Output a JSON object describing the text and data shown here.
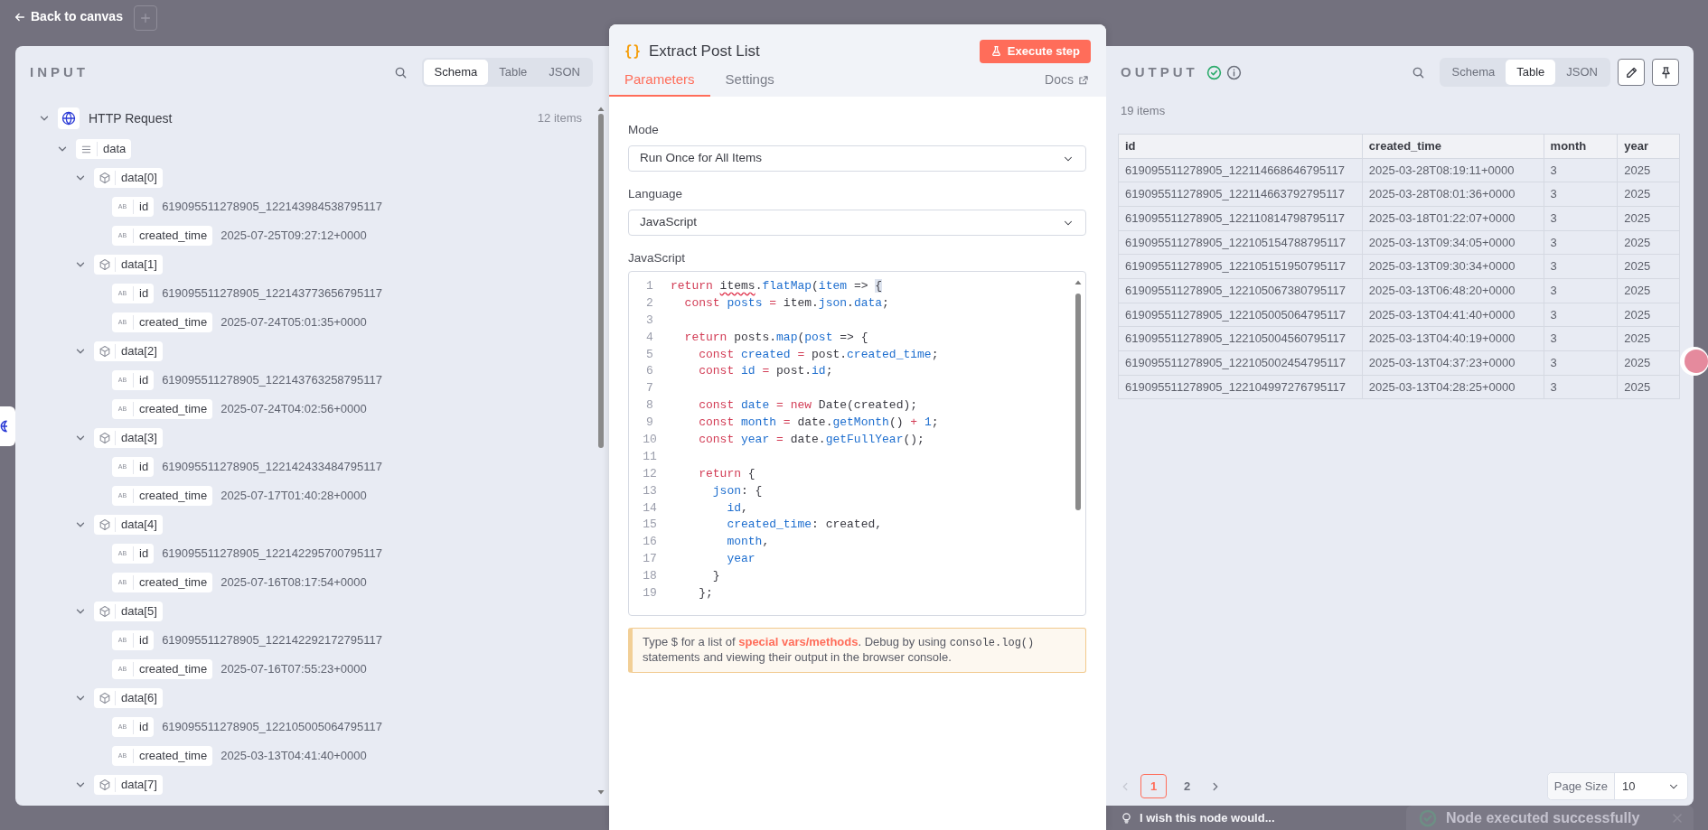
{
  "top_bar": {
    "back_link": "Back to canvas"
  },
  "input": {
    "title": "INPUT",
    "views": [
      {
        "label": "Schema",
        "selected": true
      },
      {
        "label": "Table",
        "selected": false
      },
      {
        "label": "JSON",
        "selected": false
      }
    ],
    "tree": [
      {
        "kind": "node",
        "label": "HTTP Request",
        "count": "12 items",
        "expanded": true,
        "children": [
          {
            "kind": "array",
            "label": "data",
            "expanded": true,
            "children": [
              {
                "kind": "object",
                "label": "data[0]",
                "expanded": true,
                "children": [
                  {
                    "kind": "string",
                    "type": "AB",
                    "label": "id",
                    "value": "619095511278905_122143984538795117"
                  },
                  {
                    "kind": "string",
                    "type": "AB",
                    "label": "created_time",
                    "value": "2025-07-25T09:27:12+0000"
                  }
                ]
              },
              {
                "kind": "object",
                "label": "data[1]",
                "expanded": true,
                "children": [
                  {
                    "kind": "string",
                    "type": "AB",
                    "label": "id",
                    "value": "619095511278905_122143773656795117"
                  },
                  {
                    "kind": "string",
                    "type": "AB",
                    "label": "created_time",
                    "value": "2025-07-24T05:01:35+0000"
                  }
                ]
              },
              {
                "kind": "object",
                "label": "data[2]",
                "expanded": true,
                "children": [
                  {
                    "kind": "string",
                    "type": "AB",
                    "label": "id",
                    "value": "619095511278905_122143763258795117"
                  },
                  {
                    "kind": "string",
                    "type": "AB",
                    "label": "created_time",
                    "value": "2025-07-24T04:02:56+0000"
                  }
                ]
              },
              {
                "kind": "object",
                "label": "data[3]",
                "expanded": true,
                "children": [
                  {
                    "kind": "string",
                    "type": "AB",
                    "label": "id",
                    "value": "619095511278905_122142433484795117"
                  },
                  {
                    "kind": "string",
                    "type": "AB",
                    "label": "created_time",
                    "value": "2025-07-17T01:40:28+0000"
                  }
                ]
              },
              {
                "kind": "object",
                "label": "data[4]",
                "expanded": true,
                "children": [
                  {
                    "kind": "string",
                    "type": "AB",
                    "label": "id",
                    "value": "619095511278905_122142295700795117"
                  },
                  {
                    "kind": "string",
                    "type": "AB",
                    "label": "created_time",
                    "value": "2025-07-16T08:17:54+0000"
                  }
                ]
              },
              {
                "kind": "object",
                "label": "data[5]",
                "expanded": true,
                "children": [
                  {
                    "kind": "string",
                    "type": "AB",
                    "label": "id",
                    "value": "619095511278905_122142292172795117"
                  },
                  {
                    "kind": "string",
                    "type": "AB",
                    "label": "created_time",
                    "value": "2025-07-16T07:55:23+0000"
                  }
                ]
              },
              {
                "kind": "object",
                "label": "data[6]",
                "expanded": true,
                "children": [
                  {
                    "kind": "string",
                    "type": "AB",
                    "label": "id",
                    "value": "619095511278905_122105005064795117"
                  },
                  {
                    "kind": "string",
                    "type": "AB",
                    "label": "created_time",
                    "value": "2025-03-13T04:41:40+0000"
                  }
                ]
              },
              {
                "kind": "object",
                "label": "data[7]",
                "expanded": true
              }
            ]
          }
        ]
      }
    ]
  },
  "node": {
    "title": "Extract Post List",
    "execute_button": "Execute step",
    "tabs": [
      {
        "label": "Parameters",
        "selected": true
      },
      {
        "label": "Settings",
        "selected": false
      }
    ],
    "docs_link": "Docs",
    "fields": [
      {
        "label": "Mode",
        "value": "Run Once for All Items"
      },
      {
        "label": "Language",
        "value": "JavaScript"
      }
    ],
    "code_label": "JavaScript",
    "code_lines": [
      {
        "num": "1",
        "tokens": [
          {
            "kind": "keyword",
            "text": "return "
          },
          {
            "kind": "misspelled",
            "text": "items"
          },
          {
            "kind": "plain",
            "text": "."
          },
          {
            "kind": "name",
            "text": "flatMap"
          },
          {
            "kind": "plain",
            "text": "("
          },
          {
            "kind": "name",
            "text": "item"
          },
          {
            "kind": "plain",
            "text": " => "
          },
          {
            "kind": "matched-bracket",
            "text": "{"
          }
        ]
      },
      {
        "num": "2",
        "tokens": [
          {
            "kind": "keyword",
            "text": "  const "
          },
          {
            "kind": "name",
            "text": "posts"
          },
          {
            "kind": "operator",
            "text": " = "
          },
          {
            "kind": "plain",
            "text": "item."
          },
          {
            "kind": "name",
            "text": "json"
          },
          {
            "kind": "plain",
            "text": "."
          },
          {
            "kind": "name",
            "text": "data"
          },
          {
            "kind": "plain",
            "text": ";"
          }
        ]
      },
      {
        "num": "3"
      },
      {
        "num": "4",
        "tokens": [
          {
            "kind": "keyword",
            "text": "  return "
          },
          {
            "kind": "plain",
            "text": "posts."
          },
          {
            "kind": "name",
            "text": "map"
          },
          {
            "kind": "plain",
            "text": "("
          },
          {
            "kind": "name",
            "text": "post"
          },
          {
            "kind": "plain",
            "text": " => {"
          }
        ]
      },
      {
        "num": "5",
        "tokens": [
          {
            "kind": "keyword",
            "text": "    const "
          },
          {
            "kind": "name",
            "text": "created"
          },
          {
            "kind": "operator",
            "text": " = "
          },
          {
            "kind": "plain",
            "text": "post."
          },
          {
            "kind": "name",
            "text": "created_time"
          },
          {
            "kind": "plain",
            "text": ";"
          }
        ]
      },
      {
        "num": "6",
        "tokens": [
          {
            "kind": "keyword",
            "text": "    const "
          },
          {
            "kind": "name",
            "text": "id"
          },
          {
            "kind": "operator",
            "text": " = "
          },
          {
            "kind": "plain",
            "text": "post."
          },
          {
            "kind": "name",
            "text": "id"
          },
          {
            "kind": "plain",
            "text": ";"
          }
        ]
      },
      {
        "num": "7"
      },
      {
        "num": "8",
        "tokens": [
          {
            "kind": "keyword",
            "text": "    const "
          },
          {
            "kind": "name",
            "text": "date"
          },
          {
            "kind": "operator",
            "text": " = "
          },
          {
            "kind": "keyword",
            "text": "new "
          },
          {
            "kind": "plain",
            "text": "Date(created);"
          }
        ]
      },
      {
        "num": "9",
        "tokens": [
          {
            "kind": "keyword",
            "text": "    const "
          },
          {
            "kind": "name",
            "text": "month"
          },
          {
            "kind": "operator",
            "text": " = "
          },
          {
            "kind": "plain",
            "text": "date."
          },
          {
            "kind": "name",
            "text": "getMonth"
          },
          {
            "kind": "plain",
            "text": "() "
          },
          {
            "kind": "operator",
            "text": "+"
          },
          {
            "kind": "name",
            "text": " 1"
          },
          {
            "kind": "plain",
            "text": ";"
          }
        ]
      },
      {
        "num": "10",
        "tokens": [
          {
            "kind": "keyword",
            "text": "    const "
          },
          {
            "kind": "name",
            "text": "year"
          },
          {
            "kind": "operator",
            "text": " = "
          },
          {
            "kind": "plain",
            "text": "date."
          },
          {
            "kind": "name",
            "text": "getFullYear"
          },
          {
            "kind": "plain",
            "text": "();"
          }
        ]
      },
      {
        "num": "11"
      },
      {
        "num": "12",
        "tokens": [
          {
            "kind": "keyword",
            "text": "    return "
          },
          {
            "kind": "plain",
            "text": "{"
          }
        ]
      },
      {
        "num": "13",
        "tokens": [
          {
            "kind": "name",
            "text": "      json"
          },
          {
            "kind": "plain",
            "text": ": {"
          }
        ]
      },
      {
        "num": "14",
        "tokens": [
          {
            "kind": "name",
            "text": "        id"
          },
          {
            "kind": "plain",
            "text": ","
          }
        ]
      },
      {
        "num": "15",
        "tokens": [
          {
            "kind": "name",
            "text": "        created_time"
          },
          {
            "kind": "plain",
            "text": ": created,"
          }
        ]
      },
      {
        "num": "16",
        "tokens": [
          {
            "kind": "name",
            "text": "        month"
          },
          {
            "kind": "plain",
            "text": ","
          }
        ]
      },
      {
        "num": "17",
        "tokens": [
          {
            "kind": "name",
            "text": "        year"
          }
        ]
      },
      {
        "num": "18",
        "tokens": [
          {
            "kind": "plain",
            "text": "      }"
          }
        ]
      },
      {
        "num": "19",
        "tokens": [
          {
            "kind": "plain",
            "text": "    };"
          }
        ]
      }
    ],
    "hint": [
      {
        "kind": "text",
        "text": "Type $ for a list of "
      },
      {
        "kind": "link",
        "text": "special vars/methods"
      },
      {
        "kind": "text",
        "text": ". Debug by using "
      },
      {
        "kind": "code",
        "text": "console.log()"
      },
      {
        "kind": "text",
        "text": " statements and viewing their output in the browser console."
      }
    ]
  },
  "output": {
    "title": "OUTPUT",
    "views": [
      {
        "label": "Schema",
        "selected": false
      },
      {
        "label": "Table",
        "selected": true
      },
      {
        "label": "JSON",
        "selected": false
      }
    ],
    "item_count": "19 items",
    "table": {
      "columns": [
        "id",
        "created_time",
        "month",
        "year"
      ],
      "rows": [
        [
          "619095511278905_122114668646795117",
          "2025-03-28T08:19:11+0000",
          "3",
          "2025"
        ],
        [
          "619095511278905_122114663792795117",
          "2025-03-28T08:01:36+0000",
          "3",
          "2025"
        ],
        [
          "619095511278905_122110814798795117",
          "2025-03-18T01:22:07+0000",
          "3",
          "2025"
        ],
        [
          "619095511278905_122105154788795117",
          "2025-03-13T09:34:05+0000",
          "3",
          "2025"
        ],
        [
          "619095511278905_122105151950795117",
          "2025-03-13T09:30:34+0000",
          "3",
          "2025"
        ],
        [
          "619095511278905_122105067380795117",
          "2025-03-13T06:48:20+0000",
          "3",
          "2025"
        ],
        [
          "619095511278905_122105005064795117",
          "2025-03-13T04:41:40+0000",
          "3",
          "2025"
        ],
        [
          "619095511278905_122105004560795117",
          "2025-03-13T04:40:19+0000",
          "3",
          "2025"
        ],
        [
          "619095511278905_122105002454795117",
          "2025-03-13T04:37:23+0000",
          "3",
          "2025"
        ],
        [
          "619095511278905_122104997276795117",
          "2025-03-13T04:28:25+0000",
          "3",
          "2025"
        ]
      ]
    },
    "pagination": {
      "previous": {
        "disabled": true
      },
      "next": {
        "disabled": false
      },
      "pages": [
        {
          "label": "1",
          "selected": true
        },
        {
          "label": "2",
          "selected": false
        }
      ]
    },
    "page_size": {
      "label": "Page Size",
      "value": "10"
    }
  },
  "feedback_prompt": "I wish this node would...",
  "toast": {
    "message": "Node executed successfully"
  }
}
